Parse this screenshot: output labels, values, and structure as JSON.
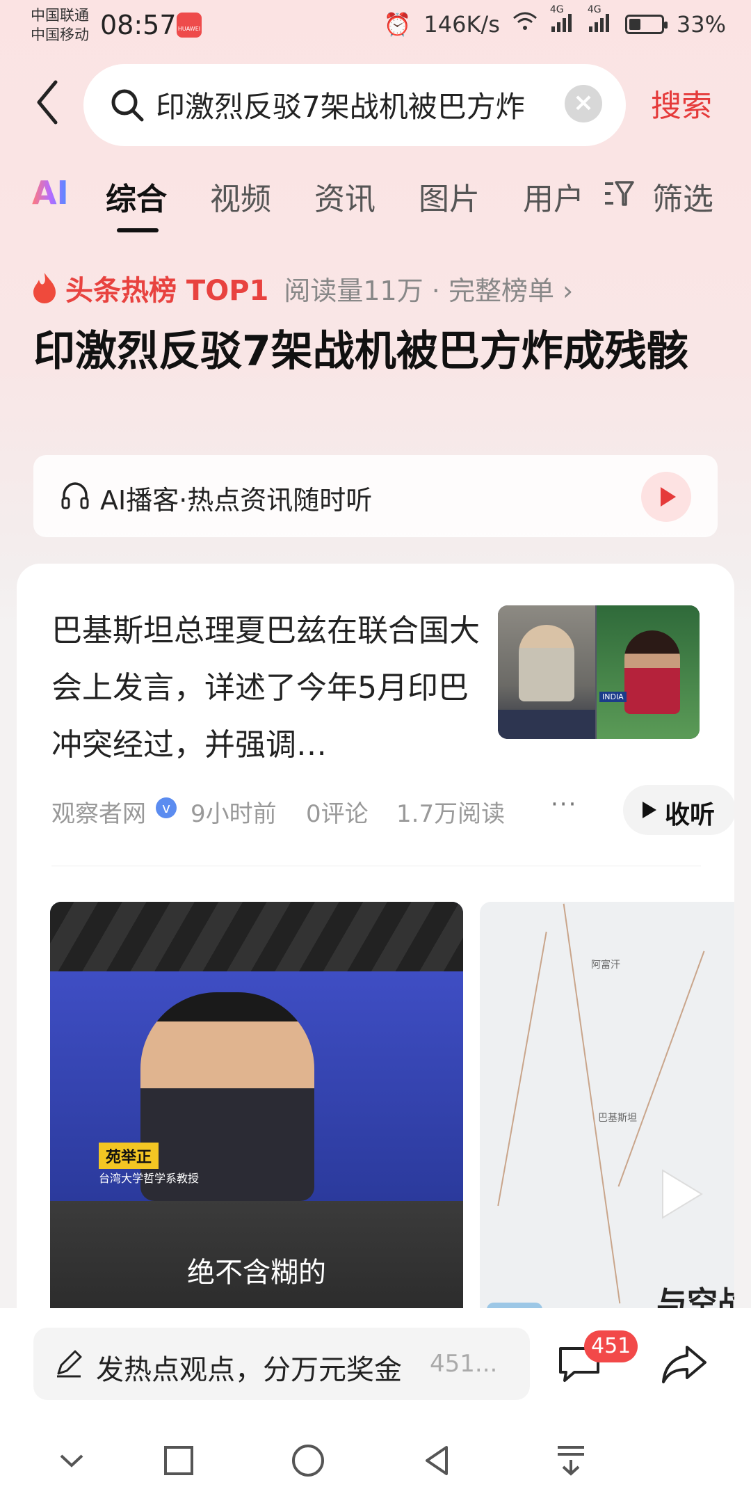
{
  "status": {
    "carrier1": "中国联通",
    "carrier2": "中国移动",
    "time": "08:57",
    "net_speed": "146K/s",
    "signal_a": "4G",
    "signal_b": "4G",
    "battery": "33%",
    "battery_level": 0.33
  },
  "search": {
    "query": "印激烈反驳7架战机被巴方炸",
    "submit_label": "搜索"
  },
  "tabs": [
    "AI",
    "综合",
    "视频",
    "资讯",
    "图片",
    "用户",
    "筛选"
  ],
  "active_tab": "综合",
  "hot": {
    "label": "头条热榜 TOP1",
    "meta": "阅读量11万 · 完整榜单 ›"
  },
  "headline": "印激烈反驳7架战机被巴方炸成残骸",
  "podcast": {
    "text": "AI播客·热点资讯随时听"
  },
  "article": {
    "text": "巴基斯坦总理夏巴兹在联合国大会上发言，详述了今年5月印巴冲突经过，并强调…",
    "thumb_label": "INDIA",
    "source": "观察者网",
    "time": "9小时前",
    "comments": "0评论",
    "reads": "1.7万阅读",
    "listen_label": "收听"
  },
  "videos": [
    {
      "name_tag": "苑举正",
      "title_tag": "台湾大学哲学系教授",
      "caption": "绝不含糊的"
    },
    {
      "city": "巴基斯坦",
      "city2": "阿富汗",
      "overlay": "与空战"
    }
  ],
  "bottom": {
    "comment_prompt": "发热点观点，分万元奖金",
    "comment_count_preview": "451...",
    "badge_count": "451"
  }
}
